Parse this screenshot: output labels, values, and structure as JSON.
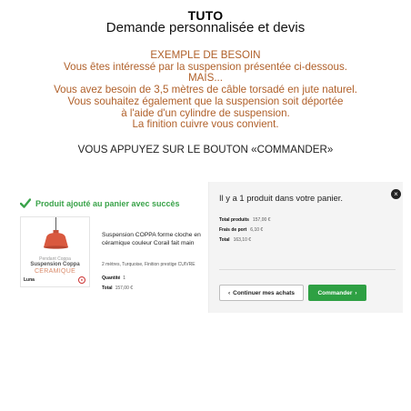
{
  "header": {
    "title": "TUTO",
    "subtitle": "Demande personnalisée et devis"
  },
  "instructions": [
    "EXEMPLE DE BESOIN",
    "Vous êtes intéressé par la suspension présentée ci-dessous.",
    "MAIS...",
    "Vous avez besoin de 3,5 mètres de câble torsadé en jute naturel.",
    "Vous souhaitez également que la suspension soit déportée",
    "à l'aide d'un cylindre de suspension.",
    "La finition cuivre vous convient."
  ],
  "cta_note": "VOUS APPUYEZ SUR LE BOUTON «COMMANDER»",
  "confirmation": "Produit ajouté au panier avec succès",
  "product": {
    "thumb_line1": "Pendant Coppa",
    "thumb_line2": "Suspension Coppa",
    "thumb_line3": "CERAMIQUE",
    "thumb_brand": "Luna",
    "name": "Suspension COPPA forme cloche en céramique couleur Corail fait main",
    "options": "2 mètres, Turquoise, Finition prestige CUIVRE",
    "qty_label": "Quantité",
    "qty_value": "1",
    "total_label": "Total",
    "total_value": "157,00 €"
  },
  "summary": {
    "heading": "Il y a 1 produit dans votre panier.",
    "lines": [
      {
        "label": "Total produits",
        "value": "157,00 €"
      },
      {
        "label": "Frais de port",
        "value": "6,10 €"
      },
      {
        "label": "Total",
        "value": "163,10 €"
      }
    ],
    "continue_label": "Continuer mes achats",
    "order_label": "Commander"
  },
  "colors": {
    "instruction_text": "#b0602a",
    "success_green": "#3aa34a",
    "order_button": "#2ea043",
    "lamp_coral": "#d9593f"
  },
  "icons": {
    "confirm": "check-icon",
    "close": "close-icon",
    "continue": "chevron-left-icon",
    "order": "chevron-right-icon"
  }
}
